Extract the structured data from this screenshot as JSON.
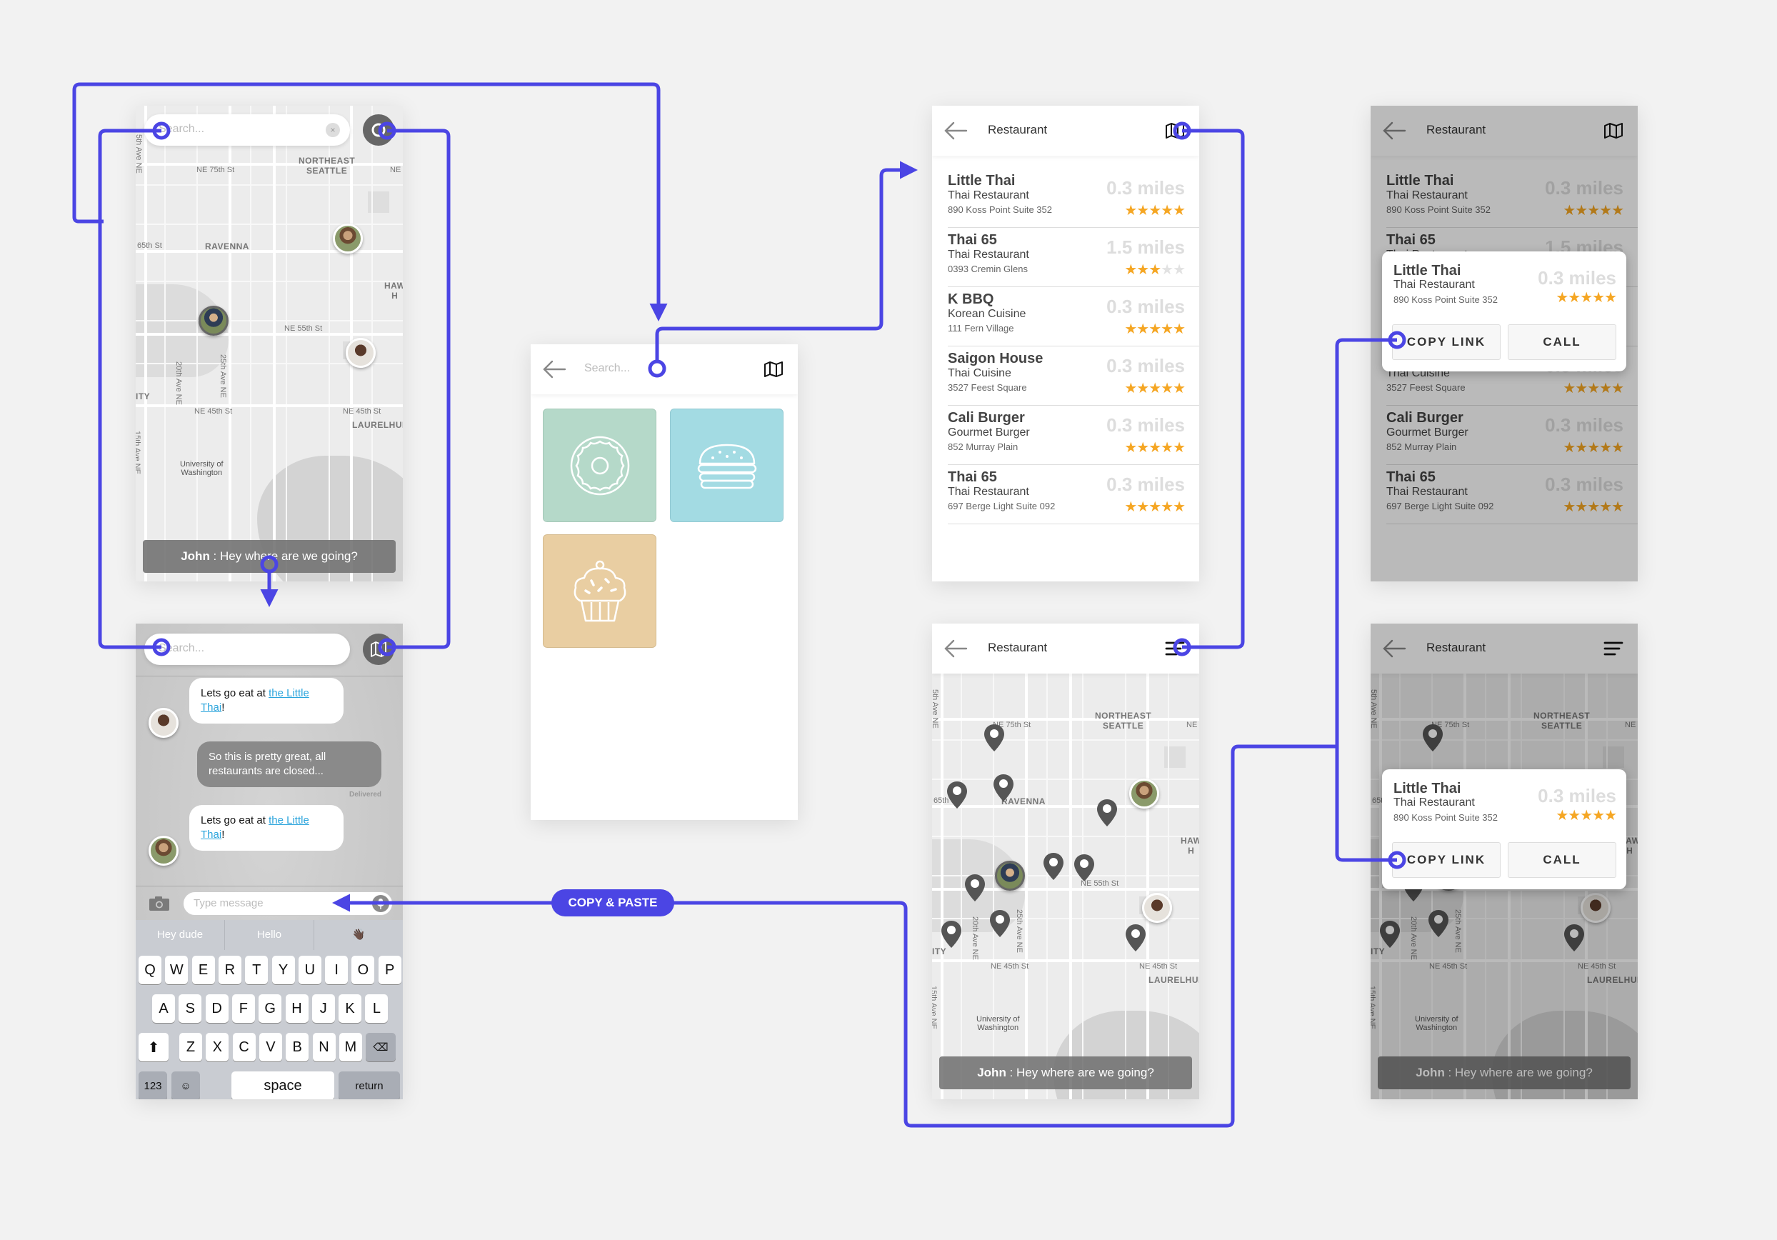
{
  "colors": {
    "connector": "#4b45e4",
    "star": "#f5a623",
    "tile_donut": "#b5d9c9",
    "tile_burger": "#a3dbe3",
    "tile_cupcake": "#e9cea2",
    "link": "#2aa4dc"
  },
  "map_screen": {
    "search_placeholder": "Search...",
    "clear_icon": "×",
    "toggle_icon": "map-toggle-icon",
    "toast_name": "John",
    "toast_message": " : Hey where are we going?",
    "map_labels": {
      "ne75": "NE 75th St",
      "northeast": "NORTHEAST",
      "seattle": "SEATTLE",
      "ne": "NE",
      "st65": "65th St",
      "ravenna": "RAVENNA",
      "haw": "HAW",
      "h": "H",
      "ne55": "NE 55th St",
      "ity": "ITY",
      "ne45a": "NE 45th St",
      "ne45b": "NE 45th St",
      "laurelhurst": "LAURELHURS",
      "uw1": "University of",
      "uw2": "Washington",
      "ave20": "20th Ave NE",
      "ave25": "25th Ave NE",
      "ave15": "15th Ave NE",
      "ave5": "5th Ave NE"
    }
  },
  "chat_screen": {
    "search_placeholder": "Search...",
    "messages": [
      {
        "from": "them",
        "text": "Lets go eat at ",
        "link": "the Little Thai",
        "suffix": "!"
      },
      {
        "from": "me",
        "text": "So this is pretty great, all restaurants are closed..."
      },
      {
        "from": "them",
        "text": "Lets go eat at ",
        "link": "the Little Thai",
        "suffix": "!"
      }
    ],
    "delivered": "Delivered",
    "input_placeholder": "Type message",
    "suggestions": [
      "Hey dude",
      "Hello",
      "👋🏿"
    ],
    "keyboard": {
      "row1": [
        "Q",
        "W",
        "E",
        "R",
        "T",
        "Y",
        "U",
        "I",
        "O",
        "P"
      ],
      "row2": [
        "A",
        "S",
        "D",
        "F",
        "G",
        "H",
        "J",
        "K",
        "L"
      ],
      "row3": [
        "Z",
        "X",
        "C",
        "V",
        "B",
        "N",
        "M"
      ],
      "shift": "⬆",
      "backspace": "⌫",
      "numbers": "123",
      "emoji": "☺",
      "space": "space",
      "return": "return"
    }
  },
  "category_screen": {
    "search_placeholder": "Search...",
    "tiles": [
      {
        "name": "donut",
        "icon": "donut-icon"
      },
      {
        "name": "burger",
        "icon": "burger-icon"
      },
      {
        "name": "cupcake",
        "icon": "cupcake-icon"
      }
    ]
  },
  "list_screen": {
    "title": "Restaurant",
    "restaurants": [
      {
        "name": "Little Thai",
        "type": "Thai Restaurant",
        "address": "890 Koss Point Suite 352",
        "distance": "0.3 miles",
        "rating": 5
      },
      {
        "name": "Thai 65",
        "type": "Thai Restaurant",
        "address": "0393 Cremin Glens",
        "distance": "1.5 miles",
        "rating": 3
      },
      {
        "name": "K BBQ",
        "type": "Korean Cuisine",
        "address": "111 Fern Village",
        "distance": "0.3 miles",
        "rating": 5
      },
      {
        "name": "Saigon House",
        "type": "Thai Cuisine",
        "address": "3527 Feest Square",
        "distance": "0.3 miles",
        "rating": 5
      },
      {
        "name": "Cali Burger",
        "type": "Gourmet Burger",
        "address": "852 Murray Plain",
        "distance": "0.3 miles",
        "rating": 5
      },
      {
        "name": "Thai 65",
        "type": "Thai Restaurant",
        "address": "697 Berge Light Suite 092",
        "distance": "0.3 miles",
        "rating": 5
      }
    ]
  },
  "map_list_screen": {
    "title": "Restaurant",
    "toast_name": "John",
    "toast_message": " : Hey where are we going?"
  },
  "popup": {
    "name": "Little Thai",
    "type": "Thai Restaurant",
    "address": "890 Koss Point Suite 352",
    "distance": "0.3 miles",
    "rating": 5,
    "copy_link": "COPY LINK",
    "call": "CALL"
  },
  "flow": {
    "copy_paste_label": "COPY & PASTE"
  }
}
